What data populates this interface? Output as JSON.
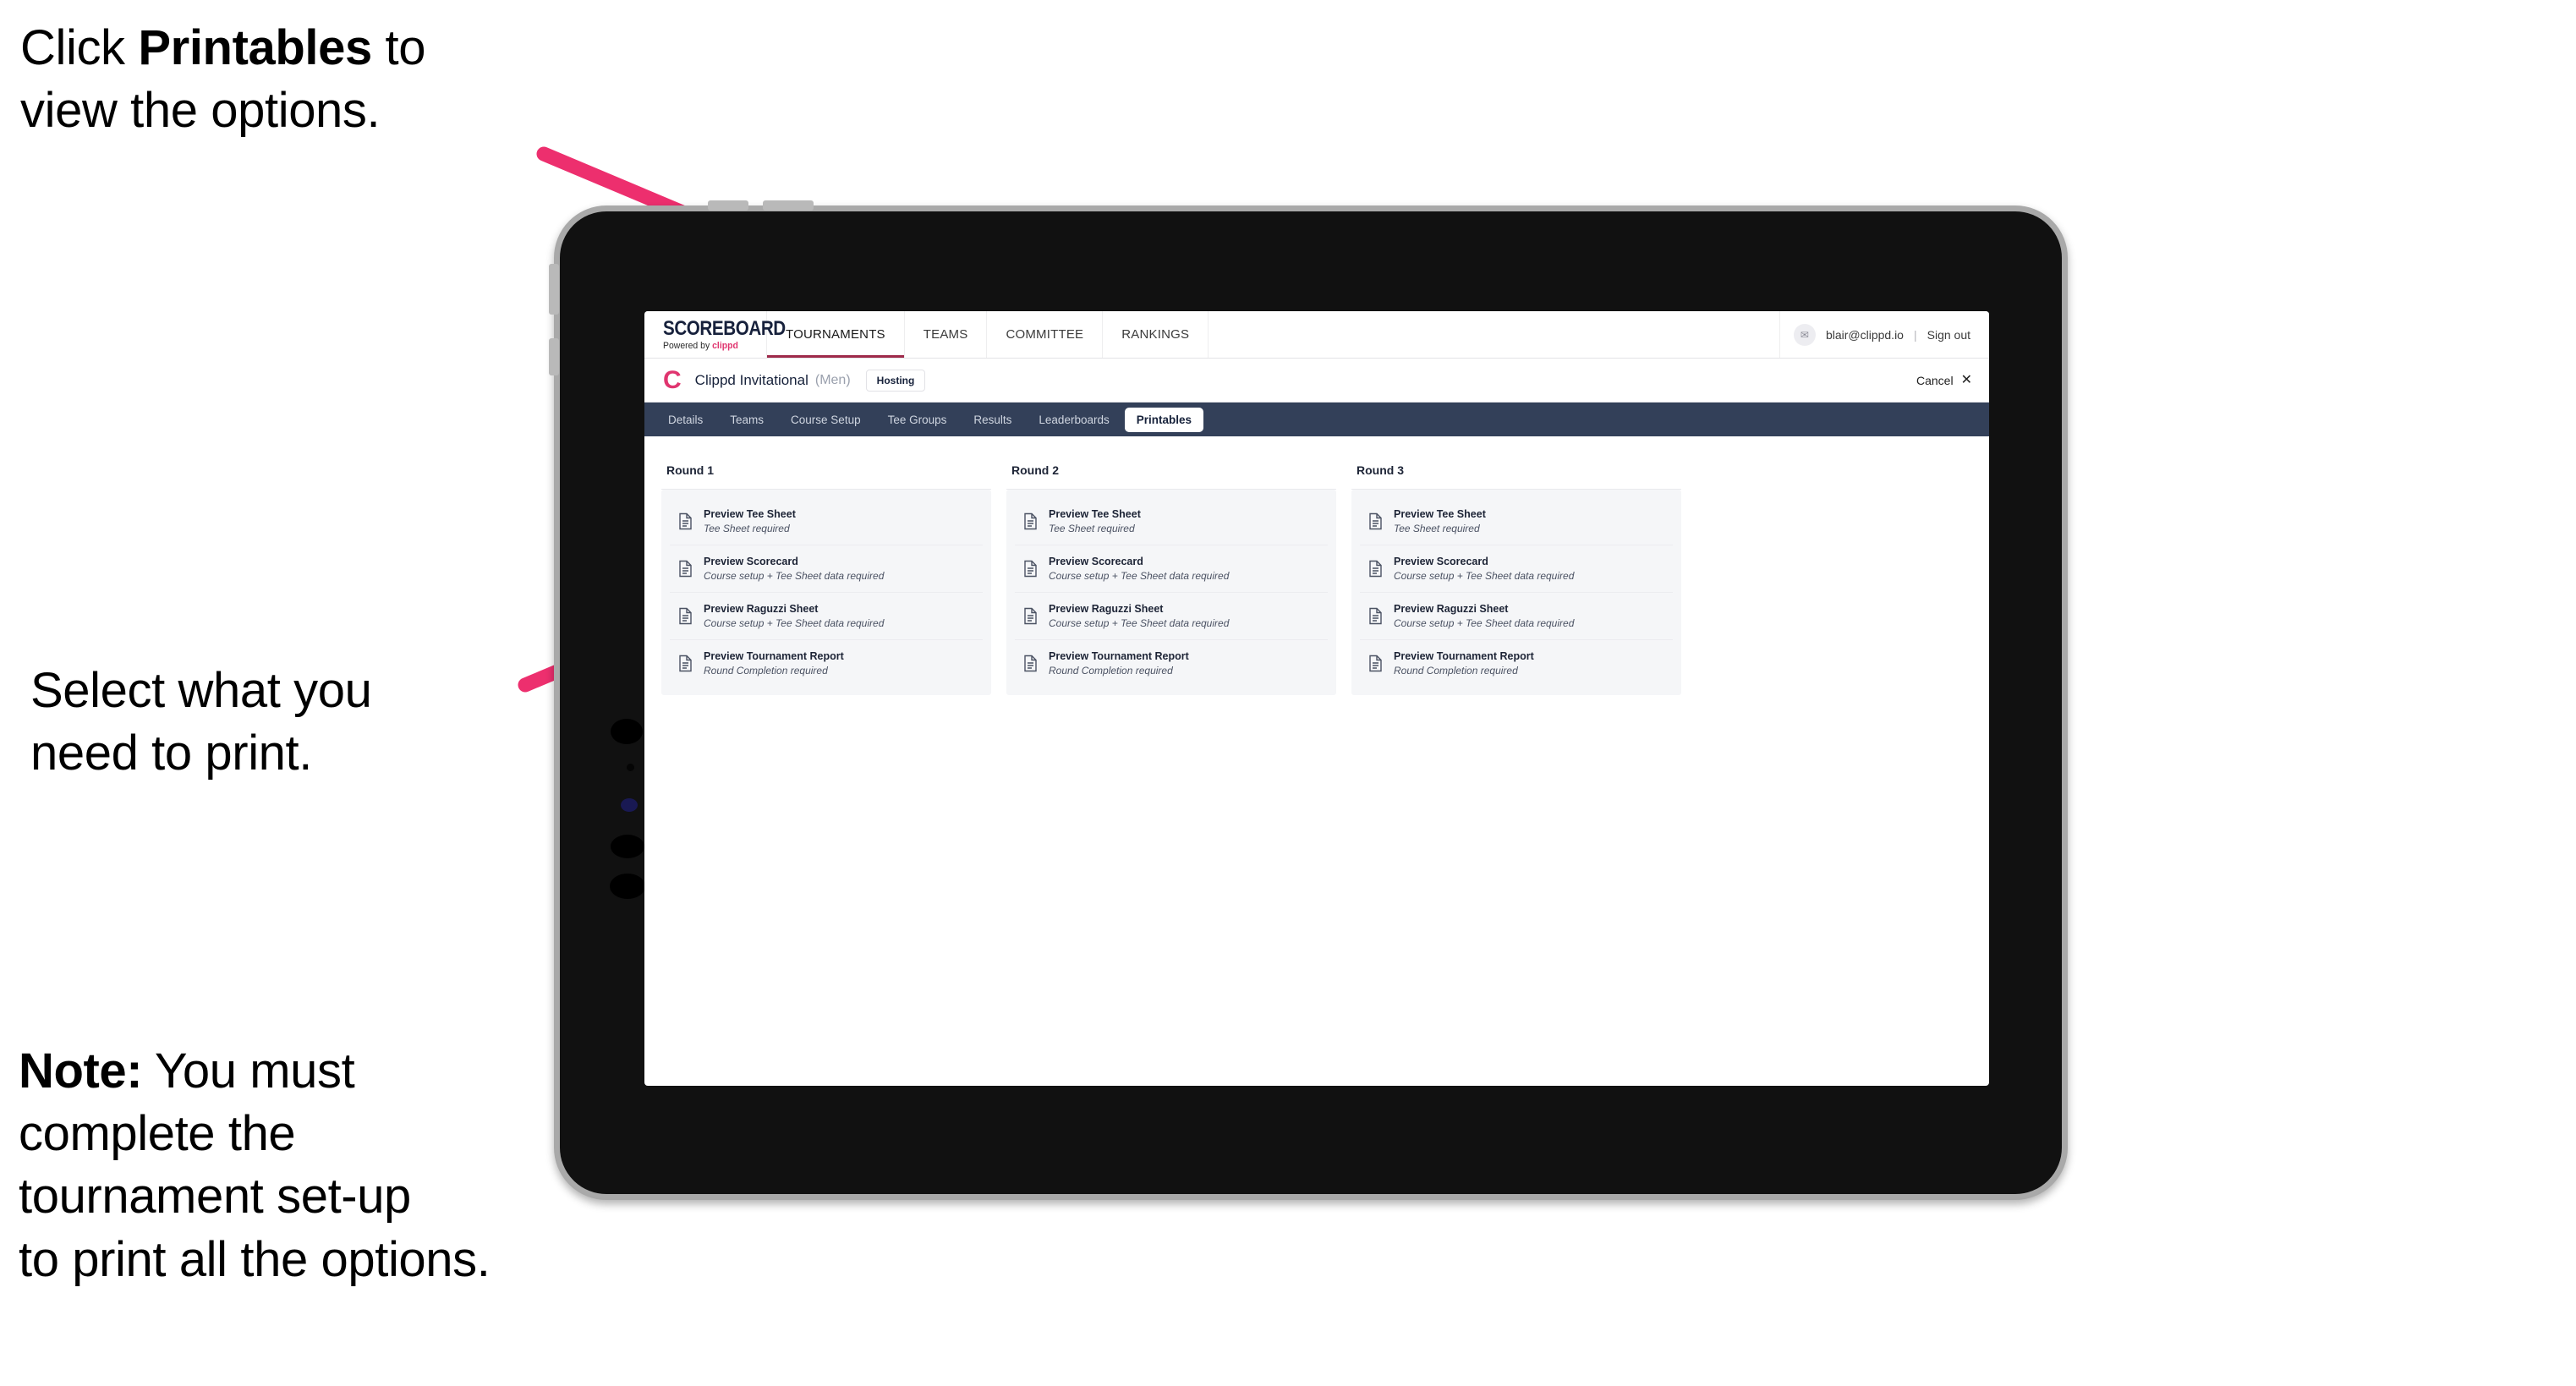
{
  "annotations": {
    "top": "Click **Printables** to\nview the options.",
    "top_plain_1": "Click ",
    "top_bold": "Printables",
    "top_plain_2": " to\nview the options.",
    "middle": "Select what you\n need to print.",
    "note_bold": "Note:",
    "note_rest": " You must\ncomplete the\ntournament set-up\nto print all the options."
  },
  "app": {
    "logo": {
      "wordmark": "SCOREBOARD",
      "powered_prefix": "Powered by ",
      "powered_brand": "clippd"
    },
    "topnav": [
      {
        "label": "TOURNAMENTS",
        "active": true
      },
      {
        "label": "TEAMS",
        "active": false
      },
      {
        "label": "COMMITTEE",
        "active": false
      },
      {
        "label": "RANKINGS",
        "active": false
      }
    ],
    "account": {
      "avatar_glyph": "✉",
      "email": "blair@clippd.io",
      "separator": "|",
      "sign_out": "Sign out"
    },
    "tournament": {
      "brand_mark": "C",
      "name": "Clippd Invitational",
      "gender": "(Men)",
      "status_badge": "Hosting",
      "cancel_label": "Cancel",
      "cancel_icon": "✕"
    },
    "tabs": [
      {
        "label": "Details",
        "active": false
      },
      {
        "label": "Teams",
        "active": false
      },
      {
        "label": "Course Setup",
        "active": false
      },
      {
        "label": "Tee Groups",
        "active": false
      },
      {
        "label": "Results",
        "active": false
      },
      {
        "label": "Leaderboards",
        "active": false
      },
      {
        "label": "Printables",
        "active": true
      }
    ],
    "rounds": [
      {
        "title": "Round 1",
        "items": [
          {
            "title": "Preview Tee Sheet",
            "sub": "Tee Sheet required",
            "icon": "document-icon"
          },
          {
            "title": "Preview Scorecard",
            "sub": "Course setup + Tee Sheet data required",
            "icon": "document-icon"
          },
          {
            "title": "Preview Raguzzi Sheet",
            "sub": "Course setup + Tee Sheet data required",
            "icon": "document-icon"
          },
          {
            "title": "Preview Tournament Report",
            "sub": "Round Completion required",
            "icon": "document-icon"
          }
        ]
      },
      {
        "title": "Round 2",
        "items": [
          {
            "title": "Preview Tee Sheet",
            "sub": "Tee Sheet required",
            "icon": "document-icon"
          },
          {
            "title": "Preview Scorecard",
            "sub": "Course setup + Tee Sheet data required",
            "icon": "document-icon"
          },
          {
            "title": "Preview Raguzzi Sheet",
            "sub": "Course setup + Tee Sheet data required",
            "icon": "document-icon"
          },
          {
            "title": "Preview Tournament Report",
            "sub": "Round Completion required",
            "icon": "document-icon"
          }
        ]
      },
      {
        "title": "Round 3",
        "items": [
          {
            "title": "Preview Tee Sheet",
            "sub": "Tee Sheet required",
            "icon": "document-icon"
          },
          {
            "title": "Preview Scorecard",
            "sub": "Course setup + Tee Sheet data required",
            "icon": "document-icon"
          },
          {
            "title": "Preview Raguzzi Sheet",
            "sub": "Course setup + Tee Sheet data required",
            "icon": "document-icon"
          },
          {
            "title": "Preview Tournament Report",
            "sub": "Round Completion required",
            "icon": "document-icon"
          }
        ]
      }
    ]
  },
  "colors": {
    "accent_pink": "#ed2f6e",
    "brand_pink": "#e0356f",
    "tabstrip_navy": "#334059",
    "nav_underline": "#9e2a4a",
    "card_bg": "#f5f6f8"
  }
}
